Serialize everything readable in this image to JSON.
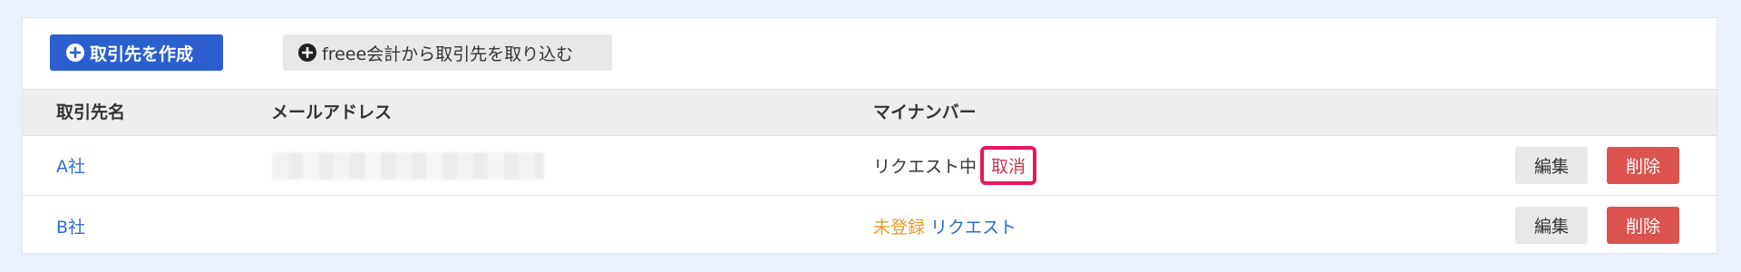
{
  "toolbar": {
    "create_label": "取引先を作成",
    "import_label": "freee会計から取引先を取り込む"
  },
  "table": {
    "headers": {
      "name": "取引先名",
      "email": "メールアドレス",
      "mynumber": "マイナンバー"
    },
    "rows": [
      {
        "name": "A社",
        "status": "リクエスト中",
        "action": "取消",
        "edit_label": "編集",
        "delete_label": "削除"
      },
      {
        "name": "B社",
        "status": "未登録",
        "action": "リクエスト",
        "edit_label": "編集",
        "delete_label": "削除"
      }
    ]
  },
  "colors": {
    "primary": "#2b5fd0",
    "link": "#2e6bc6",
    "warning": "#e89a2c",
    "danger": "#db524f",
    "highlight": "#e8175d"
  },
  "icons": {
    "create": "plus-circle-icon",
    "import": "plus-circle-icon"
  }
}
